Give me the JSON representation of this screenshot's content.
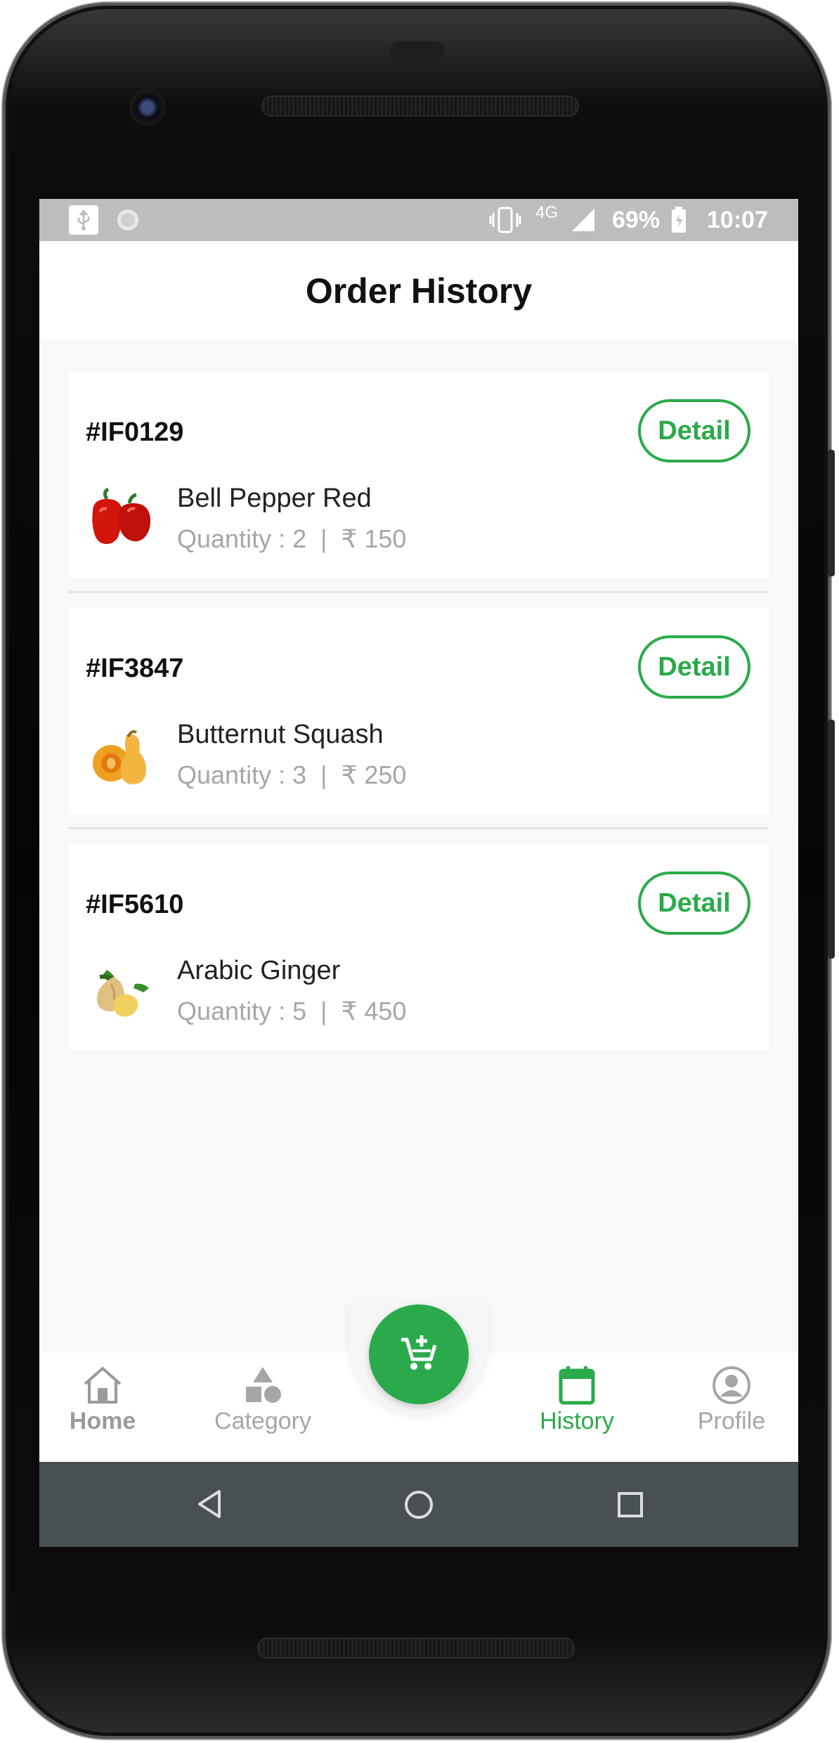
{
  "status_bar": {
    "network": "4G",
    "battery": "69%",
    "time": "10:07"
  },
  "header": {
    "title": "Order History"
  },
  "orders": [
    {
      "id": "#IF0129",
      "detail_label": "Detail",
      "item_name": "Bell Pepper Red",
      "quantity_text": "Quantity : 2  |  ₹ 150",
      "image_icon": "bell-pepper-image"
    },
    {
      "id": "#IF3847",
      "detail_label": "Detail",
      "item_name": "Butternut Squash",
      "quantity_text": "Quantity : 3  |  ₹ 250",
      "image_icon": "butternut-squash-image"
    },
    {
      "id": "#IF5610",
      "detail_label": "Detail",
      "item_name": "Arabic Ginger",
      "quantity_text": "Quantity : 5  |  ₹ 450",
      "image_icon": "ginger-image"
    }
  ],
  "bottom_nav": {
    "items": [
      {
        "label": "Home",
        "icon": "home-icon"
      },
      {
        "label": "Category",
        "icon": "category-icon"
      },
      {
        "label": "History",
        "icon": "calendar-icon",
        "active": true
      },
      {
        "label": "Profile",
        "icon": "profile-icon"
      }
    ],
    "fab_icon": "add-to-cart-icon"
  },
  "colors": {
    "accent": "#2aaa4a",
    "muted": "#a6a6a6",
    "status_bar": "#bdbdbd",
    "system_nav": "#495054"
  }
}
